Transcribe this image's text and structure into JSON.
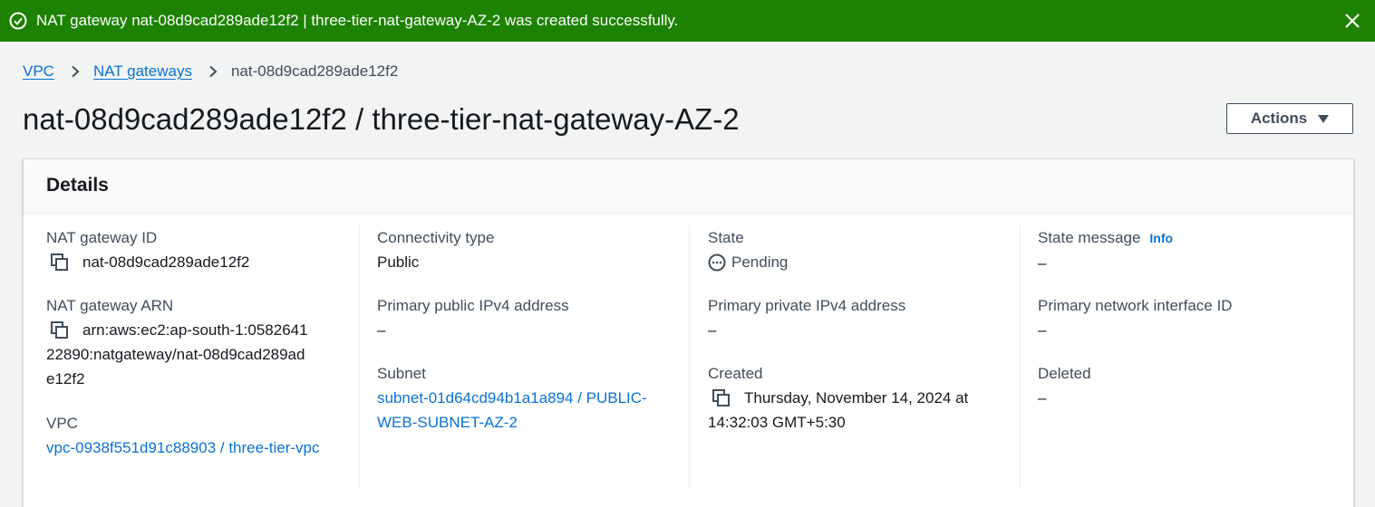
{
  "flash": {
    "message": "NAT gateway nat-08d9cad289ade12f2 | three-tier-nat-gateway-AZ-2 was created successfully.",
    "icon": "check-circle-icon",
    "close_icon": "close-icon",
    "color": "#1d8102"
  },
  "breadcrumb": {
    "items": [
      "VPC",
      "NAT gateways"
    ],
    "current": "nat-08d9cad289ade12f2"
  },
  "page": {
    "title": "nat-08d9cad289ade12f2 / three-tier-nat-gateway-AZ-2",
    "actions_label": "Actions"
  },
  "details": {
    "heading": "Details",
    "nat_gateway_id": {
      "label": "NAT gateway ID",
      "value": "nat-08d9cad289ade12f2"
    },
    "nat_gateway_arn": {
      "label": "NAT gateway ARN",
      "value": "arn:aws:ec2:ap-south-1:058264122890:natgateway/nat-08d9cad289ade12f2"
    },
    "vpc": {
      "label": "VPC",
      "value": "vpc-0938f551d91c88903 / three-tier-vpc"
    },
    "connectivity_type": {
      "label": "Connectivity type",
      "value": "Public"
    },
    "primary_public_ipv4": {
      "label": "Primary public IPv4 address",
      "value": "–"
    },
    "subnet": {
      "label": "Subnet",
      "value": "subnet-01d64cd94b1a1a894 / PUBLIC-WEB-SUBNET-AZ-2"
    },
    "state": {
      "label": "State",
      "value": "Pending"
    },
    "primary_private_ipv4": {
      "label": "Primary private IPv4 address",
      "value": "–"
    },
    "created": {
      "label": "Created",
      "value": "Thursday, November 14, 2024 at 14:32:03 GMT+5:30"
    },
    "state_message": {
      "label": "State message",
      "info": "Info",
      "value": "–"
    },
    "primary_network_interface": {
      "label": "Primary network interface ID",
      "value": "–"
    },
    "deleted": {
      "label": "Deleted",
      "value": "–"
    }
  }
}
